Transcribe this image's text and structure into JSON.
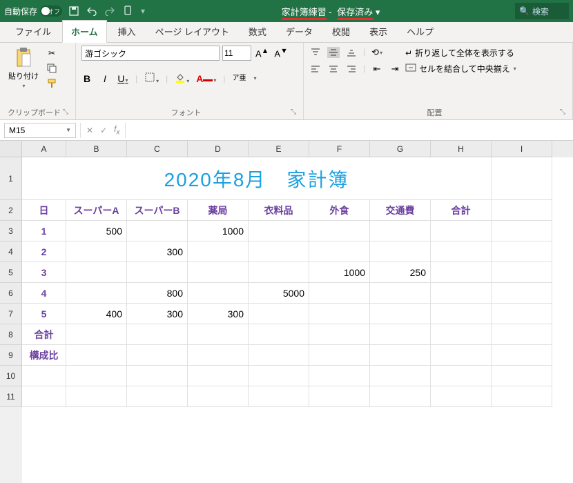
{
  "titlebar": {
    "autosave_label": "自動保存",
    "autosave_state": "オフ",
    "filename": "家計簿練習",
    "saved_status": "保存済み",
    "search_placeholder": "検索"
  },
  "tabs": [
    "ファイル",
    "ホーム",
    "挿入",
    "ページ レイアウト",
    "数式",
    "データ",
    "校閲",
    "表示",
    "ヘルプ"
  ],
  "active_tab": "ホーム",
  "ribbon": {
    "clipboard": {
      "paste": "貼り付け",
      "label": "クリップボード"
    },
    "font": {
      "name": "游ゴシック",
      "size": "11",
      "bold": "B",
      "italic": "I",
      "underline": "U",
      "ruby": "ア亜",
      "label": "フォント"
    },
    "alignment": {
      "wrap": "折り返して全体を表示する",
      "merge": "セルを結合して中央揃え",
      "label": "配置"
    }
  },
  "formula_bar": {
    "namebox": "M15",
    "formula": ""
  },
  "columns": [
    "A",
    "B",
    "C",
    "D",
    "E",
    "F",
    "G",
    "H",
    "I"
  ],
  "row_numbers": [
    "1",
    "2",
    "3",
    "4",
    "5",
    "6",
    "7",
    "8",
    "9",
    "10",
    "11"
  ],
  "sheet": {
    "title": "2020年8月　家計簿",
    "headers": [
      "日",
      "スーパーA",
      "スーパーB",
      "薬局",
      "衣料品",
      "外食",
      "交通費",
      "合計"
    ],
    "rows": [
      {
        "day": "1",
        "vals": [
          "500",
          "",
          "1000",
          "",
          "",
          "",
          ""
        ]
      },
      {
        "day": "2",
        "vals": [
          "",
          "300",
          "",
          "",
          "",
          "",
          ""
        ]
      },
      {
        "day": "3",
        "vals": [
          "",
          "",
          "",
          "",
          "1000",
          "250",
          ""
        ]
      },
      {
        "day": "4",
        "vals": [
          "",
          "800",
          "",
          "5000",
          "",
          "",
          ""
        ]
      },
      {
        "day": "5",
        "vals": [
          "400",
          "300",
          "300",
          "",
          "",
          "",
          ""
        ]
      }
    ],
    "total_label": "合計",
    "ratio_label": "構成比"
  },
  "chart_data": {
    "type": "table",
    "title": "2020年8月　家計簿",
    "columns": [
      "日",
      "スーパーA",
      "スーパーB",
      "薬局",
      "衣料品",
      "外食",
      "交通費",
      "合計"
    ],
    "rows": [
      [
        1,
        500,
        null,
        1000,
        null,
        null,
        null,
        null
      ],
      [
        2,
        null,
        300,
        null,
        null,
        null,
        null,
        null
      ],
      [
        3,
        null,
        null,
        null,
        null,
        1000,
        250,
        null
      ],
      [
        4,
        null,
        800,
        null,
        5000,
        null,
        null,
        null
      ],
      [
        5,
        400,
        300,
        300,
        null,
        null,
        null,
        null
      ]
    ]
  }
}
